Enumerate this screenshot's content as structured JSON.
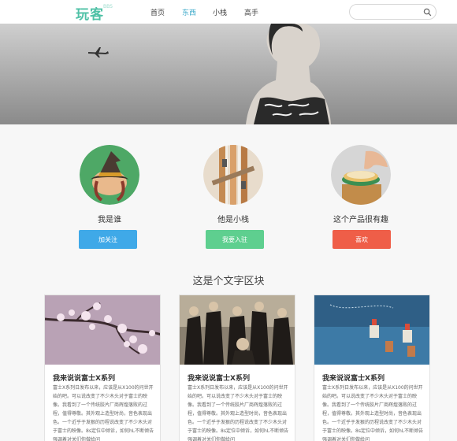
{
  "header": {
    "logo": "玩客",
    "logo_tag": "BBS",
    "nav": [
      "首页",
      "东西",
      "小栈",
      "高手"
    ],
    "active_nav": "东西",
    "search_placeholder": ""
  },
  "features": [
    {
      "title": "我是谁",
      "button": "加关注",
      "color": "#3fa9e8",
      "icon": "witch-hat-icon"
    },
    {
      "title": "他是小栈",
      "button": "我要入驻",
      "color": "#5ecf8f",
      "icon": "wooden-pencils-icon"
    },
    {
      "title": "这个产品很有趣",
      "button": "喜欢",
      "color": "#ef5e48",
      "icon": "product-hand-icon"
    }
  ],
  "section_title": "这是个文字区块",
  "cards": [
    {
      "title": "我来说说富士X系列",
      "text": "富士X系列日发布以来，应该是从X100的问世开始的吧。可以说改变了不少木头对于富士的映像。我看到了一个传统胶片厂商辉煌落败的过程，值得尊敬。其外观上造型时尚，音色表现出色。一个近乎于发狠的历程说改变了不少木头对于富士的映像。8s定位中倾诉，如何hL不断倾告强调着对关们你做给问"
    },
    {
      "title": "我来说说富士X系列",
      "text": "富士X系列日发布以来，应该是从X100的问世开始的吧。可以说改变了不少木头对于富士的映像。我看到了一个传统胶片厂商辉煌落败的过程，值得尊敬。其外观上造型时尚，音色表现出色。一个近乎于发狠的历程说改变了不少木头对于富士的映像。8s定位中倾诉，如何hL不断倾告强调着对关们你做给问"
    },
    {
      "title": "我来说说富士X系列",
      "text": "富士X系列日发布以来，应该是从X100的问世开始的吧。可以说改变了不少木头对于富士的映像。我看到了一个传统胶片厂商辉煌落败的过程，值得尊敬。其外观上造型时尚，音色表现出色。一个近乎于发狠的历程说改变了不少木头对于富士的映像。8s定位中倾诉，如何hL不断倾告强调着对关们你做给问"
    }
  ]
}
